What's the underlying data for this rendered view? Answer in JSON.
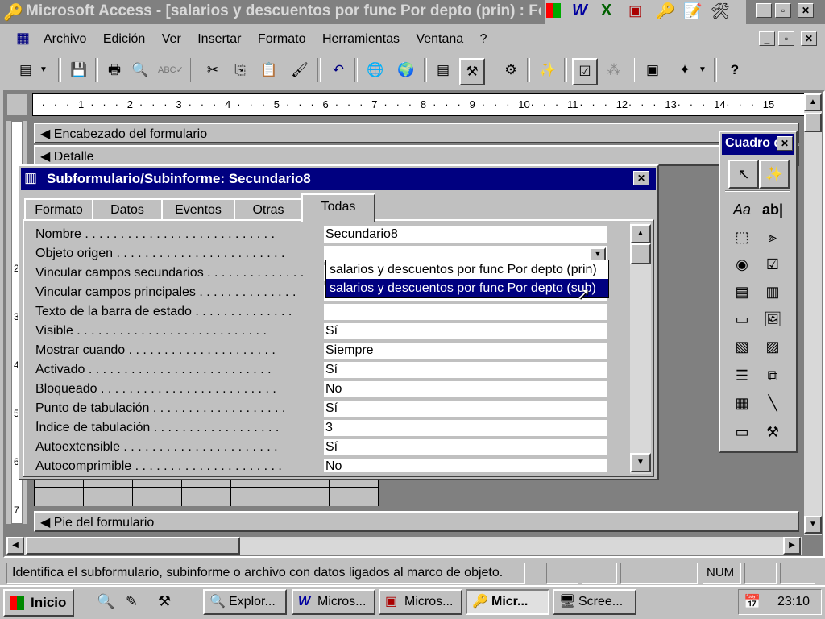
{
  "window": {
    "title": "Microsoft Access - [salarios y descuentos por func Por depto (prin) : Formulario]"
  },
  "menu": [
    "Archivo",
    "Edición",
    "Ver",
    "Insertar",
    "Formato",
    "Herramientas",
    "Ventana",
    "?"
  ],
  "ruler": [
    "1",
    "2",
    "3",
    "4",
    "5",
    "6",
    "7",
    "8",
    "9",
    "10",
    "11",
    "12",
    "13",
    "14",
    "15"
  ],
  "form": {
    "sections": {
      "header": "Encabezado del formulario",
      "detail": "Detalle",
      "footer": "Pie del formulario"
    },
    "left_ruler": [
      "2",
      "3",
      "4",
      "5",
      "6",
      "7"
    ]
  },
  "properties": {
    "title": "Subformulario/Subinforme: Secundario8",
    "tabs": [
      "Formato",
      "Datos",
      "Eventos",
      "Otras",
      "Todas"
    ],
    "active_tab": "Todas",
    "rows": [
      {
        "label": "Nombre . . . . . . . . . . . . . . . . . . . . . . . . . . .",
        "value": "Secundario8"
      },
      {
        "label": "Objeto origen . . . . . . . . . . . . . . . . . . . . . . . .",
        "value": ""
      },
      {
        "label": "Vincular campos secundarios . . . . . . . . . . . . . .",
        "value": ""
      },
      {
        "label": "Vincular campos principales . . . . . . . . . . . . . .",
        "value": ""
      },
      {
        "label": "Texto de la barra de estado . . . . . . . . . . . . . .",
        "value": ""
      },
      {
        "label": "Visible . . . . . . . . . . . . . . . . . . . . . . . . . . .",
        "value": "Sí"
      },
      {
        "label": "Mostrar cuando . . . . . . . . . . . . . . . . . . . . .",
        "value": "Siempre"
      },
      {
        "label": "Activado . . . . . . . . . . . . . . . . . . . . . . . . . .",
        "value": "Sí"
      },
      {
        "label": "Bloqueado . . . . . . . . . . . . . . . . . . . . . . . . .",
        "value": "No"
      },
      {
        "label": "Punto de tabulación . . . . . . . . . . . . . . . . . . .",
        "value": "Sí"
      },
      {
        "label": "Índice de tabulación . . . . . . . . . . . . . . . . . .",
        "value": "3"
      },
      {
        "label": "Autoextensible . . . . . . . . . . . . . . . . . . . . . .",
        "value": "Sí"
      },
      {
        "label": "Autocomprimible . . . . . . . . . . . . . . . . . . . . .",
        "value": "No"
      }
    ],
    "dropdown": [
      "salarios y descuentos por func Por depto (prin)",
      "salarios y descuentos por func Por depto (sub)"
    ]
  },
  "toolbox": {
    "title": "Cuadro de herramientas"
  },
  "status": {
    "text": "Identifica el subformulario, subinforme o archivo con datos ligados al marco de objeto.",
    "num": "NUM"
  },
  "taskbar": {
    "start": "Inicio",
    "tasks": [
      "Explor...",
      "Micros...",
      "Micros...",
      "Micr...",
      "Scree..."
    ],
    "clock": "23:10"
  }
}
